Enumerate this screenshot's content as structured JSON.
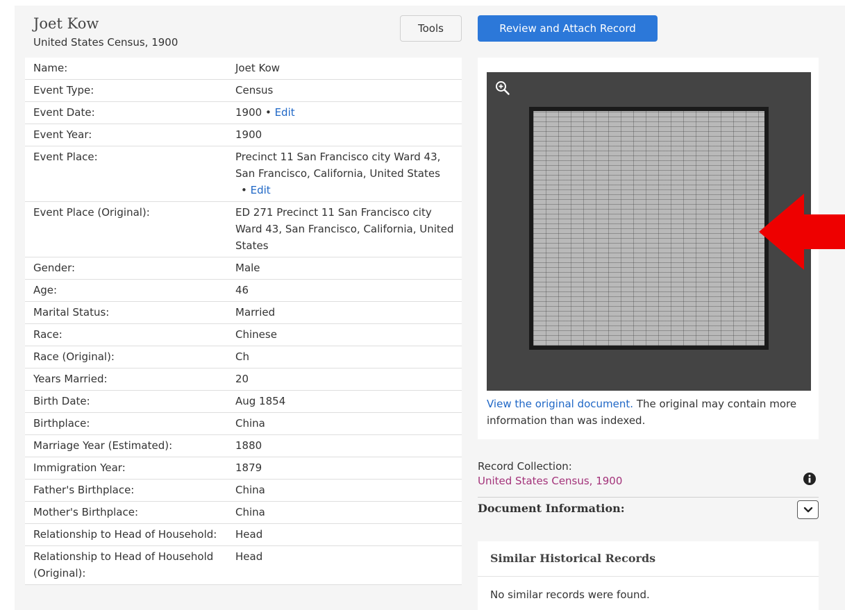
{
  "header": {
    "name": "Joet Kow",
    "collection": "United States Census, 1900",
    "tools_label": "Tools",
    "review_label": "Review and Attach Record"
  },
  "record": {
    "rows": [
      {
        "label": "Name:",
        "value": "Joet Kow"
      },
      {
        "label": "Event Type:",
        "value": "Census"
      },
      {
        "label": "Event Date:",
        "value": "1900",
        "edit": "Edit"
      },
      {
        "label": "Event Year:",
        "value": "1900"
      },
      {
        "label": "Event Place:",
        "value": "Precinct 11 San Francisco city Ward 43, San Francisco, California, United States",
        "edit": "Edit",
        "edit_newline": true
      },
      {
        "label": "Event Place (Original):",
        "value": "ED 271 Precinct 11 San Francisco city Ward 43, San Francisco, California, United States"
      },
      {
        "label": "Gender:",
        "value": "Male"
      },
      {
        "label": "Age:",
        "value": "46"
      },
      {
        "label": "Marital Status:",
        "value": "Married"
      },
      {
        "label": "Race:",
        "value": "Chinese"
      },
      {
        "label": "Race (Original):",
        "value": "Ch"
      },
      {
        "label": "Years Married:",
        "value": "20"
      },
      {
        "label": "Birth Date:",
        "value": "Aug 1854"
      },
      {
        "label": "Birthplace:",
        "value": "China"
      },
      {
        "label": "Marriage Year (Estimated):",
        "value": "1880"
      },
      {
        "label": "Immigration Year:",
        "value": "1879"
      },
      {
        "label": "Father's Birthplace:",
        "value": "China"
      },
      {
        "label": "Mother's Birthplace:",
        "value": "China"
      },
      {
        "label": "Relationship to Head of Household:",
        "value": "Head"
      },
      {
        "label": "Relationship to Head of Household (Original):",
        "value": "Head"
      }
    ]
  },
  "image": {
    "zoom_icon": "zoom-in-icon",
    "view_link": "View the original document.",
    "view_note": " The original may contain more information than was indexed."
  },
  "collection": {
    "label": "Record Collection:",
    "link": "United States Census, 1900",
    "info_icon": "info-icon"
  },
  "document_info": {
    "label": "Document Information:",
    "toggle_icon": "chevron-down-icon"
  },
  "similar": {
    "title": "Similar Historical Records",
    "empty": "No similar records were found."
  },
  "colors": {
    "primary": "#2c78d9",
    "link": "#1f67c6",
    "collection_link": "#a3337a",
    "annotation_arrow": "#ee0000"
  }
}
